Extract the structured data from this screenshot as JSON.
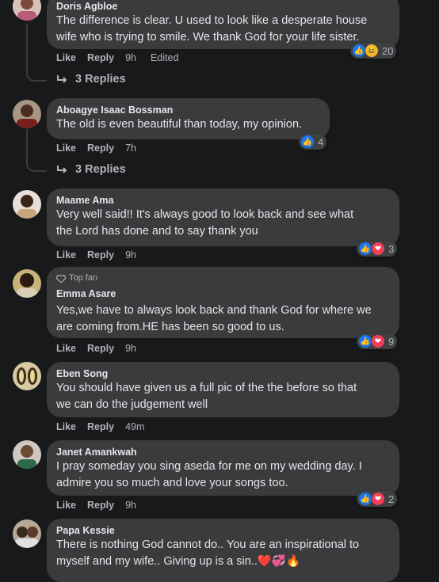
{
  "labels": {
    "like": "Like",
    "reply": "Reply"
  },
  "comments": [
    {
      "name": "Doris Agbloe",
      "text": [
        "The difference is clear. U used to look like a desperate house",
        "wife who is trying to smile. We thank God for your life sister."
      ],
      "time": "9h",
      "edited": "Edited",
      "reaction_count": "20",
      "replies": "3 Replies"
    },
    {
      "name": "Aboagye Isaac Bossman",
      "text": [
        "The old is even beautiful than today, my opinion."
      ],
      "time": "7h",
      "reaction_count": "4",
      "replies": "3 Replies"
    },
    {
      "name": "Maame Ama",
      "text": [
        "Very well said!! It's always good to look back and see what",
        "the Lord has done and to say thank you"
      ],
      "time": "9h",
      "reaction_count": "3"
    },
    {
      "name": "Emma Asare",
      "badge": "Top fan",
      "text": [
        "Yes,we have to always look back and thank God for where we",
        "are coming from.HE has been so good to us."
      ],
      "time": "9h",
      "reaction_count": "9"
    },
    {
      "name": "Eben Song",
      "text": [
        "You should have given us a full pic of the the before so that",
        "we can do the judgement well"
      ],
      "time": "49m"
    },
    {
      "name": "Janet Amankwah",
      "text": [
        "I pray someday you sing aseda for me on my wedding day. I",
        "admire you so much and love your songs too."
      ],
      "time": "9h",
      "reaction_count": "2"
    },
    {
      "name": "Papa Kessie",
      "text": [
        "There is nothing God cannot do.. You are an inspirational to",
        "myself and my wife.. Giving up is a sin.."
      ]
    }
  ]
}
